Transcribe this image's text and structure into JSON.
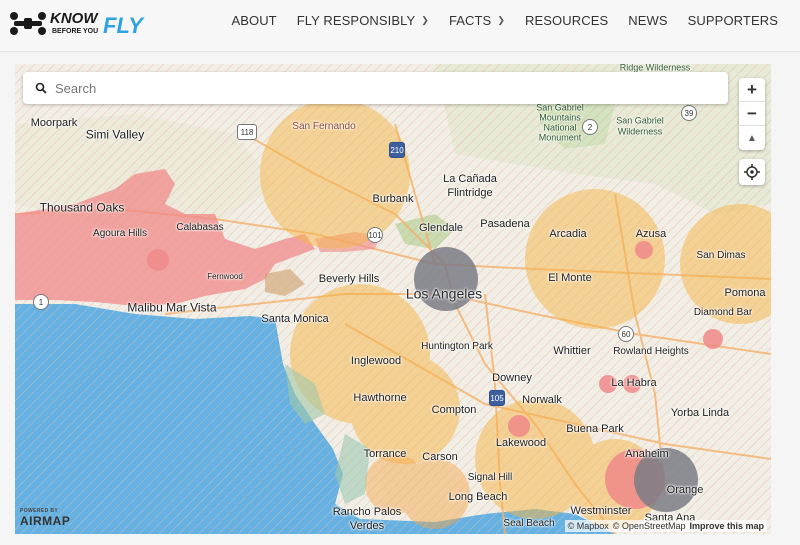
{
  "header": {
    "logo_know": "KNOW",
    "logo_fly": "FLY",
    "logo_sub": "BEFORE YOU",
    "nav": [
      {
        "label": "ABOUT",
        "dropdown": false
      },
      {
        "label": "FLY RESPONSIBLY",
        "dropdown": true
      },
      {
        "label": "FACTS",
        "dropdown": true
      },
      {
        "label": "RESOURCES",
        "dropdown": false
      },
      {
        "label": "NEWS",
        "dropdown": false
      },
      {
        "label": "SUPPORTERS",
        "dropdown": false
      }
    ]
  },
  "search": {
    "placeholder": "Search",
    "value": ""
  },
  "controls": {
    "zoom_in": "+",
    "zoom_out": "−",
    "compass": "▲"
  },
  "powered": {
    "small": "POWERED BY",
    "brand": "AIRMAP"
  },
  "attribution": {
    "mapbox": "© Mapbox",
    "osm": "© OpenStreetMap",
    "improve": "Improve this map"
  },
  "places": {
    "moorpark": "Moorpark",
    "simi_valley": "Simi Valley",
    "san_fernando": "San Fernando",
    "thousand_oaks": "Thousand Oaks",
    "agoura_hills": "Agoura Hills",
    "calabasas": "Calabasas",
    "fernwood": "Fernwood",
    "malibu_mar_vista": "Malibu Mar Vista",
    "la_canada_1": "La Cañada",
    "la_canada_2": "Flintridge",
    "burbank": "Burbank",
    "glendale": "Glendale",
    "pasadena": "Pasadena",
    "arcadia": "Arcadia",
    "azusa": "Azusa",
    "san_dimas": "San Dimas",
    "pomona": "Pomona",
    "diamond_bar": "Diamond Bar",
    "beverly_hills": "Beverly Hills",
    "los_angeles": "Los Angeles",
    "el_monte": "El Monte",
    "santa_monica": "Santa Monica",
    "huntington_park": "Huntington Park",
    "whittier": "Whittier",
    "rowland_heights": "Rowland Heights",
    "inglewood": "Inglewood",
    "downey": "Downey",
    "la_habra": "La Habra",
    "hawthorne": "Hawthorne",
    "compton": "Compton",
    "norwalk": "Norwalk",
    "yorba_linda": "Yorba Linda",
    "buena_park": "Buena Park",
    "lakewood": "Lakewood",
    "torrance": "Torrance",
    "carson": "Carson",
    "anaheim": "Anaheim",
    "signal_hill": "Signal Hill",
    "long_beach": "Long Beach",
    "orange": "Orange",
    "rancho_1": "Rancho Palos",
    "rancho_2": "Verdes",
    "seal_beach": "Seal Beach",
    "westminster": "Westminster",
    "santa_ana": "Santa Ana",
    "ridge_wilderness": "Ridge Wilderness",
    "sg_mountains_1": "San Gabriel",
    "sg_mountains_2": "Mountains",
    "sg_mountains_3": "National",
    "sg_mountains_4": "Monument",
    "sg_wilderness_1": "San Gabriel",
    "sg_wilderness_2": "Wilderness"
  },
  "shields": {
    "r118": "118",
    "r210": "210",
    "r2": "2",
    "r39": "39",
    "r101": "101",
    "r1": "1",
    "r60": "60",
    "r105": "105"
  },
  "colors": {
    "airport_zone": "#f6b547",
    "restricted": "#f08a8a",
    "heliport": "#7b7b85",
    "water": "#64b1e2",
    "land": "#f1eee6"
  }
}
